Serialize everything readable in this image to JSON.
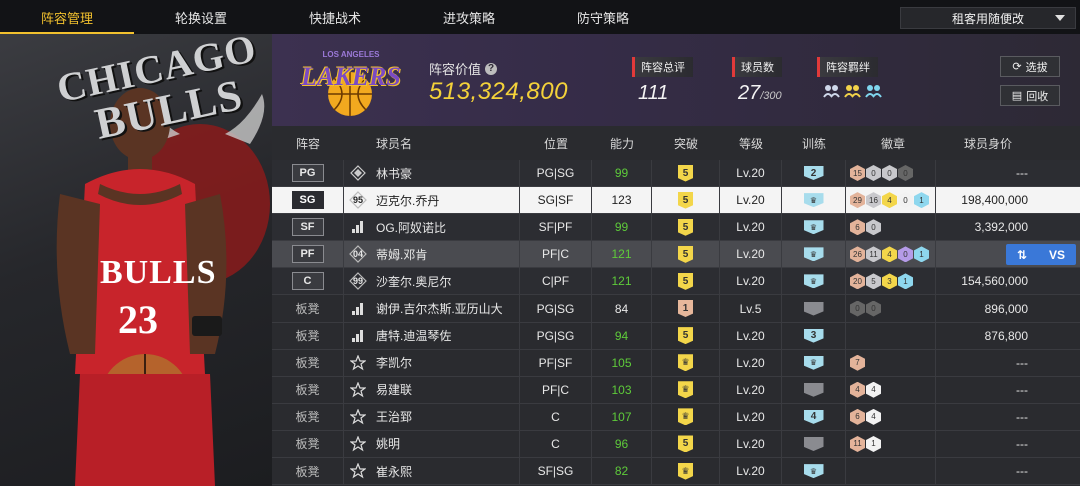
{
  "nav": {
    "tabs": [
      "阵容管理",
      "轮换设置",
      "快捷战术",
      "进攻策略",
      "防守策略"
    ],
    "active_tab": 0,
    "dropdown": "租客用随便改"
  },
  "art": {
    "team_text_1": "CHICAGO",
    "team_text_2": "BULLS"
  },
  "header": {
    "team_logo_text": "LAKERS",
    "team_logo_sub": "LOS ANGELES",
    "team_value_label": "阵容价值",
    "team_value": "513,324,800",
    "overall_label": "阵容总评",
    "overall_value": "111",
    "count_label": "球员数",
    "count_value": "27",
    "count_max": "/300",
    "chem_label": "阵容羁绊",
    "btn_select": "选拔",
    "btn_recycle": "回收"
  },
  "columns": [
    "阵容",
    "球员名",
    "位置",
    "能力",
    "突破",
    "等级",
    "训练",
    "徽章",
    "球员身价"
  ],
  "rows": [
    {
      "slot": "PG",
      "type": "starter",
      "icon": "diamond",
      "name": "林书豪",
      "pos": "PG|SG",
      "abil": "99",
      "abil_color": "green",
      "brk": "5",
      "brk_style": "gold",
      "lv": "Lv.20",
      "train": "2",
      "train_style": "blue",
      "badges": [
        [
          "15",
          "c"
        ],
        [
          "0",
          "s"
        ],
        [
          "0",
          "s"
        ],
        [
          "0",
          "e"
        ]
      ],
      "value": "---"
    },
    {
      "slot": "SG",
      "type": "starter",
      "icon": "num",
      "icon_text": "95",
      "name": "迈克尔.乔丹",
      "pos": "SG|SF",
      "abil": "123",
      "abil_color": "white",
      "brk": "5",
      "brk_style": "gold",
      "lv": "Lv.20",
      "train": "",
      "train_style": "crown",
      "badges": [
        [
          "29",
          "c"
        ],
        [
          "16",
          "s"
        ],
        [
          "4",
          "g"
        ],
        [
          "0",
          "w"
        ],
        [
          "1",
          "b"
        ]
      ],
      "value": "198,400,000",
      "selected": true
    },
    {
      "slot": "SF",
      "type": "starter",
      "icon": "bars",
      "name": "OG.阿奴诺比",
      "pos": "SF|PF",
      "abil": "99",
      "abil_color": "green",
      "brk": "5",
      "brk_style": "gold",
      "lv": "Lv.20",
      "train": "",
      "train_style": "crown",
      "badges": [
        [
          "6",
          "c"
        ],
        [
          "0",
          "s"
        ]
      ],
      "value": "3,392,000"
    },
    {
      "slot": "PF",
      "type": "starter",
      "icon": "num",
      "icon_text": "04",
      "name": "蒂姆.邓肯",
      "pos": "PF|C",
      "abil": "121",
      "abil_color": "green",
      "brk": "5",
      "brk_style": "gold",
      "lv": "Lv.20",
      "train": "",
      "train_style": "crown",
      "badges": [
        [
          "26",
          "c"
        ],
        [
          "11",
          "s"
        ],
        [
          "4",
          "g"
        ],
        [
          "0",
          "p"
        ],
        [
          "1",
          "b"
        ]
      ],
      "value": "",
      "highlight": true,
      "vs": "VS"
    },
    {
      "slot": "C",
      "type": "starter",
      "icon": "num",
      "icon_text": "99",
      "name": "沙奎尔.奥尼尔",
      "pos": "C|PF",
      "abil": "121",
      "abil_color": "green",
      "brk": "5",
      "brk_style": "gold",
      "lv": "Lv.20",
      "train": "",
      "train_style": "crown",
      "badges": [
        [
          "20",
          "c"
        ],
        [
          "5",
          "s"
        ],
        [
          "3",
          "g"
        ],
        [
          "1",
          "b"
        ]
      ],
      "value": "154,560,000"
    },
    {
      "slot": "板凳",
      "type": "bench",
      "icon": "bars",
      "name": "谢伊.吉尔杰斯.亚历山大",
      "pos": "PG|SG",
      "abil": "84",
      "abil_color": "white",
      "brk": "1",
      "brk_style": "copper",
      "lv": "Lv.5",
      "train": "",
      "train_style": "grey",
      "badges": [
        [
          "0",
          "e"
        ],
        [
          "0",
          "e"
        ]
      ],
      "value": "896,000"
    },
    {
      "slot": "板凳",
      "type": "bench",
      "icon": "bars",
      "name": "唐特.迪温琴佐",
      "pos": "PG|SG",
      "abil": "94",
      "abil_color": "green",
      "brk": "5",
      "brk_style": "gold",
      "lv": "Lv.20",
      "train": "3",
      "train_style": "blue",
      "badges": [],
      "value": "876,800"
    },
    {
      "slot": "板凳",
      "type": "bench",
      "icon": "star",
      "name": "李凯尔",
      "pos": "PF|SF",
      "abil": "105",
      "abil_color": "green",
      "brk": "",
      "brk_style": "crown",
      "lv": "Lv.20",
      "train": "",
      "train_style": "crown",
      "badges": [
        [
          "7",
          "c"
        ]
      ],
      "value": "---"
    },
    {
      "slot": "板凳",
      "type": "bench",
      "icon": "star",
      "name": "易建联",
      "pos": "PF|C",
      "abil": "103",
      "abil_color": "green",
      "brk": "",
      "brk_style": "crown",
      "lv": "Lv.20",
      "train": "",
      "train_style": "grey",
      "badges": [
        [
          "4",
          "c"
        ],
        [
          "4",
          "w"
        ]
      ],
      "value": "---"
    },
    {
      "slot": "板凳",
      "type": "bench",
      "icon": "star",
      "name": "王治郅",
      "pos": "C",
      "abil": "107",
      "abil_color": "green",
      "brk": "",
      "brk_style": "crown",
      "lv": "Lv.20",
      "train": "4",
      "train_style": "blue",
      "badges": [
        [
          "6",
          "c"
        ],
        [
          "4",
          "w"
        ]
      ],
      "value": "---"
    },
    {
      "slot": "板凳",
      "type": "bench",
      "icon": "star",
      "name": "姚明",
      "pos": "C",
      "abil": "96",
      "abil_color": "green",
      "brk": "5",
      "brk_style": "gold",
      "lv": "Lv.20",
      "train": "",
      "train_style": "grey",
      "badges": [
        [
          "11",
          "c"
        ],
        [
          "1",
          "w"
        ]
      ],
      "value": "---"
    },
    {
      "slot": "板凳",
      "type": "bench",
      "icon": "star",
      "name": "崔永熙",
      "pos": "SF|SG",
      "abil": "82",
      "abil_color": "green",
      "brk": "",
      "brk_style": "crown",
      "lv": "Lv.20",
      "train": "",
      "train_style": "crown",
      "badges": [],
      "value": "---"
    }
  ]
}
